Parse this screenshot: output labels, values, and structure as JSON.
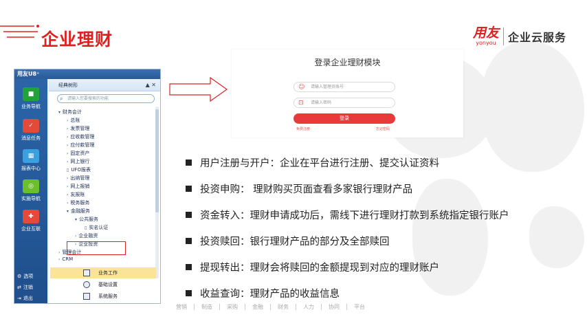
{
  "header": {
    "title": "企业理财",
    "logo_cn": "用友",
    "logo_en": "yonyou",
    "logo_text": "企业云服务"
  },
  "u8": {
    "window_title": "用友U8⁺",
    "nav": [
      {
        "label": "业务导航",
        "icon": "business-nav-icon",
        "color": "#22a33a"
      },
      {
        "label": "消息任务",
        "icon": "message-task-icon",
        "color": "#e34a3a"
      },
      {
        "label": "报表中心",
        "icon": "report-center-icon",
        "color": "#3aa0e0"
      },
      {
        "label": "实施导航",
        "icon": "implementation-nav-icon",
        "color": "#6cbf2c"
      },
      {
        "label": "企业互联",
        "icon": "enterprise-connect-icon",
        "color": "#e34a3a"
      }
    ],
    "nav_bottom": [
      {
        "label": "选项",
        "icon": "gear-icon"
      },
      {
        "label": "注销",
        "icon": "logout-icon"
      },
      {
        "label": "退出",
        "icon": "exit-icon"
      }
    ],
    "panel_title": "经典树形",
    "panel_pins": "▲ ✕",
    "search_placeholder": "请输入您要搜索的功能",
    "tree": [
      {
        "label": "财务会计",
        "arrow": "▾"
      },
      {
        "label": "总账",
        "arrow": "›"
      },
      {
        "label": "发票管理",
        "arrow": "›"
      },
      {
        "label": "应收款管理",
        "arrow": "›"
      },
      {
        "label": "应付款管理",
        "arrow": "›"
      },
      {
        "label": "固定资产",
        "arrow": "›"
      },
      {
        "label": "网上银行",
        "arrow": "›"
      },
      {
        "label": "UFO报表",
        "arrow": "▯"
      },
      {
        "label": "出纳管理",
        "arrow": "›"
      },
      {
        "label": "网上报销",
        "arrow": "›"
      },
      {
        "label": "友报账",
        "arrow": "›"
      },
      {
        "label": "税务服务",
        "arrow": "›"
      },
      {
        "label": "金融服务",
        "arrow": "▾"
      },
      {
        "label": "公共服务",
        "arrow": "▾"
      },
      {
        "label": "实名认证",
        "arrow": "▯"
      },
      {
        "label": "企业融资",
        "arrow": "›"
      },
      {
        "label": "企业投资",
        "arrow": "›"
      },
      {
        "label": "管理会计",
        "arrow": "›"
      },
      {
        "label": "CRM",
        "arrow": "›"
      }
    ],
    "bottom_tabs": [
      "业务工作",
      "基础设置",
      "系统服务"
    ]
  },
  "login": {
    "title": "登录企业理财模块",
    "account_placeholder": "请输入管理员账号",
    "password_placeholder": "请输入密码",
    "login_button": "登录",
    "register_link": "免费注册",
    "forgot_link": "忘记密码"
  },
  "bullets": [
    "用户注册与开户：企业在平台进行注册、提交认证资料",
    "投资申购：  理财购买页面查看多家银行理财产品",
    "资金转入：理财申请成功后，需线下进行理财打款到系统指定银行账户",
    "投资赎回：银行理财产品的部分及全部赎回",
    "提现转出：理财会将赎回的金额提现到对应的理财账户",
    "收益查询：理财产品的收益信息"
  ],
  "footer": [
    "营销",
    "制造",
    "采购",
    "金融",
    "财务",
    "人力",
    "协同",
    "平台"
  ],
  "colors": {
    "accent": "#e02020",
    "nav_blue": "#2b65a8"
  }
}
